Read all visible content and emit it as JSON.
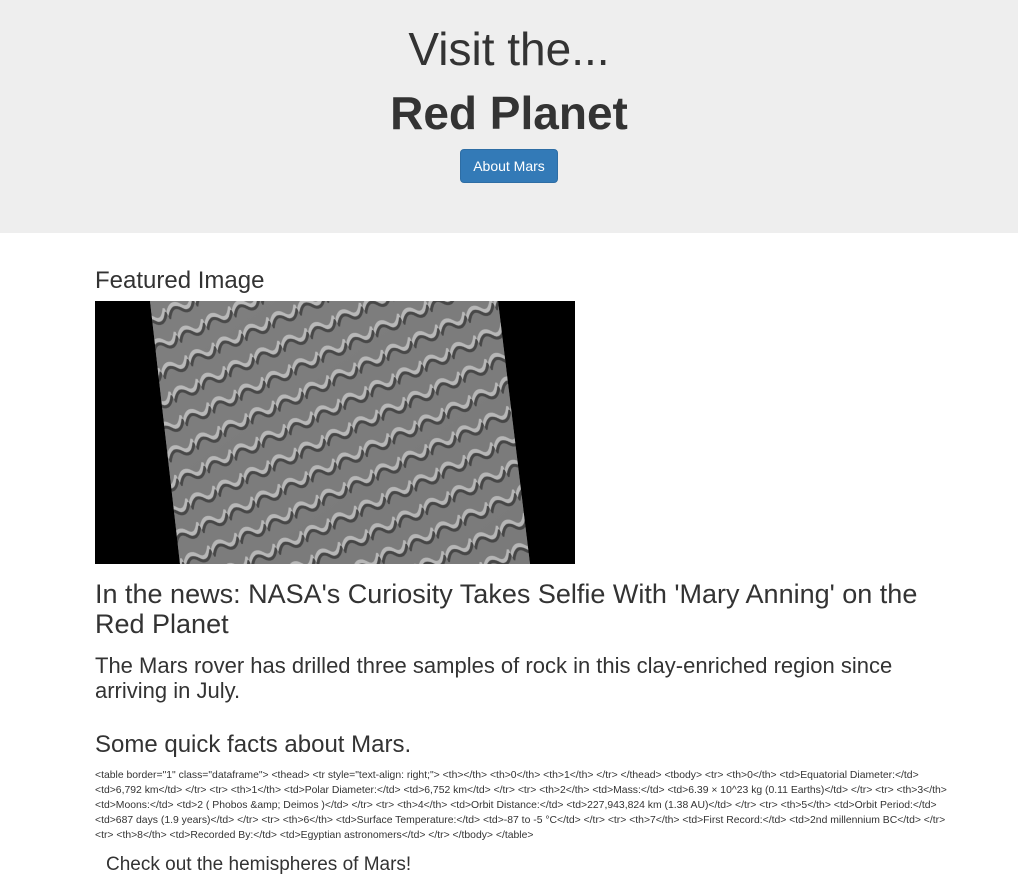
{
  "header": {
    "line1": "Visit the...",
    "line2": "Red Planet",
    "button_label": "About Mars"
  },
  "featured": {
    "heading": "Featured Image",
    "image_alt": "Mars dunes"
  },
  "news": {
    "title": "In the news: NASA's Curiosity Takes Selfie With 'Mary Anning' on the Red Planet",
    "paragraph": "The Mars rover has drilled three samples of rock in this clay-enriched region since arriving in July."
  },
  "facts": {
    "heading": "Some quick facts about Mars.",
    "table_raw": "<table border=\"1\" class=\"dataframe\"> <thead> <tr style=\"text-align: right;\"> <th></th> <th>0</th> <th>1</th> </tr> </thead> <tbody> <tr> <th>0</th> <td>Equatorial Diameter:</td> <td>6,792 km</td> </tr> <tr> <th>1</th> <td>Polar Diameter:</td> <td>6,752 km</td> </tr> <tr> <th>2</th> <td>Mass:</td> <td>6.39 × 10^23 kg (0.11 Earths)</td> </tr> <tr> <th>3</th> <td>Moons:</td> <td>2 ( Phobos &amp; Deimos )</td> </tr> <tr> <th>4</th> <td>Orbit Distance:</td> <td>227,943,824 km (1.38 AU)</td> </tr> <tr> <th>5</th> <td>Orbit Period:</td> <td>687 days (1.9 years)</td> </tr> <tr> <th>6</th> <td>Surface Temperature:</td> <td>-87 to -5 °C</td> </tr> <tr> <th>7</th> <td>First Record:</td> <td>2nd millennium BC</td> </tr> <tr> <th>8</th> <td>Recorded By:</td> <td>Egyptian astronomers</td> </tr> </tbody> </table>"
  },
  "hemispheres": {
    "link_text": "Check out the hemispheres of Mars!"
  }
}
